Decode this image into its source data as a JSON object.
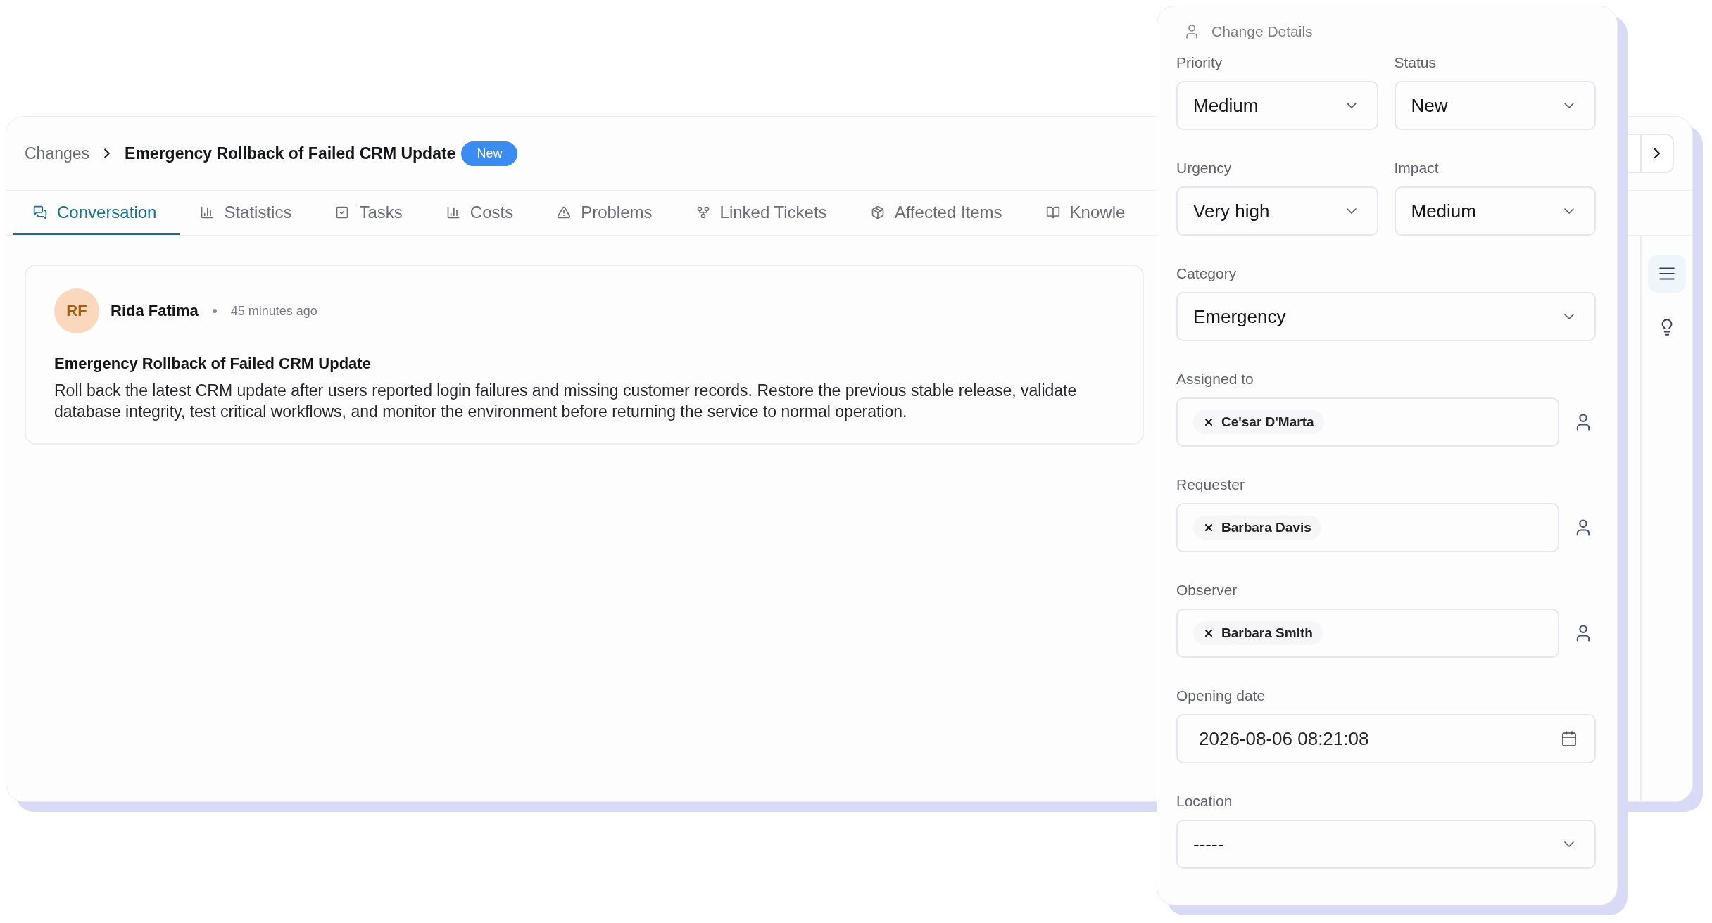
{
  "breadcrumb": {
    "parent": "Changes",
    "current": "Emergency Rollback of Failed CRM Update",
    "badge": "New"
  },
  "tabs": [
    {
      "label": "Conversation",
      "kind": "chat",
      "selected": true
    },
    {
      "label": "Statistics",
      "kind": "chart",
      "selected": false
    },
    {
      "label": "Tasks",
      "kind": "check",
      "selected": false
    },
    {
      "label": "Costs",
      "kind": "chart",
      "selected": false
    },
    {
      "label": "Problems",
      "kind": "warning",
      "selected": false
    },
    {
      "label": "Linked Tickets",
      "kind": "fork",
      "selected": false
    },
    {
      "label": "Affected Items",
      "kind": "package",
      "selected": false
    },
    {
      "label": "Knowle",
      "kind": "book",
      "selected": false
    }
  ],
  "side_tools": [
    {
      "kind": "list",
      "selected": true
    },
    {
      "kind": "bulb",
      "selected": false
    }
  ],
  "conversation": {
    "initials": "RF",
    "author": "Rida Fatima",
    "time": "45 minutes ago",
    "title": "Emergency Rollback of Failed CRM Update",
    "body": "Roll back the latest CRM update after users reported login failures and missing customer records. Restore the previous stable release, validate database integrity, test critical workflows, and monitor the environment before returning the service to normal operation."
  },
  "panel": {
    "title": "Change Details",
    "rows": [
      [
        {
          "kind": "select",
          "label": "Priority",
          "value": "Medium"
        },
        {
          "kind": "select",
          "label": "Status",
          "value": "New"
        }
      ],
      [
        {
          "kind": "select",
          "label": "Urgency",
          "value": "Very high"
        },
        {
          "kind": "select",
          "label": "Impact",
          "value": "Medium"
        }
      ],
      [
        {
          "kind": "select",
          "label": "Category",
          "value": "Emergency"
        }
      ],
      [
        {
          "kind": "people",
          "label": "Assigned to",
          "value": "Ce'sar D'Marta"
        }
      ],
      [
        {
          "kind": "people",
          "label": "Requester",
          "value": "Barbara Davis"
        }
      ],
      [
        {
          "kind": "people",
          "label": "Observer",
          "value": "Barbara Smith"
        }
      ],
      [
        {
          "kind": "date",
          "label": "Opening date",
          "value": "2026-08-06 08:21:08"
        }
      ],
      [
        {
          "kind": "select",
          "label": "Location",
          "value": "-----"
        }
      ]
    ]
  }
}
